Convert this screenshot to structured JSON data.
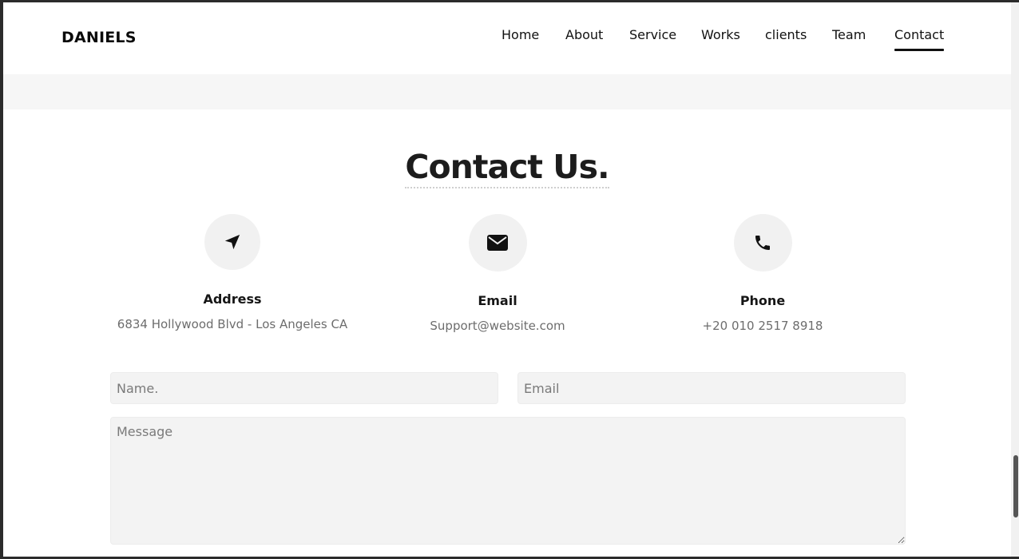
{
  "brand": {
    "logo": "DANIELS"
  },
  "nav": {
    "items": [
      {
        "label": "Home"
      },
      {
        "label": "About"
      },
      {
        "label": "Service"
      },
      {
        "label": "Works"
      },
      {
        "label": "clients"
      },
      {
        "label": "Team"
      },
      {
        "label": "Contact",
        "active": true
      }
    ]
  },
  "contact": {
    "title": "Contact Us.",
    "cards": [
      {
        "icon": "location-arrow-icon",
        "title": "Address",
        "text": "6834 Hollywood Blvd - Los Angeles CA"
      },
      {
        "icon": "envelope-icon",
        "title": "Email",
        "text": "Support@website.com"
      },
      {
        "icon": "phone-icon",
        "title": "Phone",
        "text": "+20 010 2517 8918"
      }
    ]
  },
  "form": {
    "name_placeholder": "Name.",
    "email_placeholder": "Email",
    "message_placeholder": "Message"
  },
  "colors": {
    "accent": "#111111",
    "band": "#f6f6f6",
    "field_bg": "#f3f3f3",
    "icon_bg": "#f1f1f1",
    "muted_text": "#6d6d6d"
  }
}
